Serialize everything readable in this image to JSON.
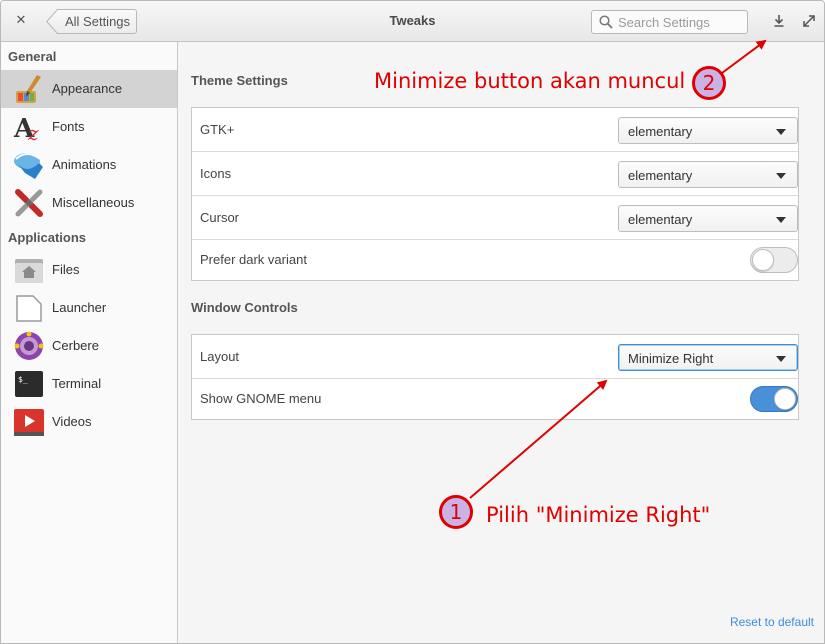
{
  "window": {
    "title": "Tweaks",
    "back_label": "All Settings",
    "close_glyph": "✕"
  },
  "search": {
    "placeholder": "Search Settings",
    "value": ""
  },
  "header_icons": [
    "minimize-icon",
    "maximize-icon"
  ],
  "sidebar": {
    "groups": [
      {
        "label": "General",
        "items": [
          {
            "label": "Appearance",
            "icon": "appearance-icon",
            "selected": true
          },
          {
            "label": "Fonts",
            "icon": "fonts-icon",
            "selected": false
          },
          {
            "label": "Animations",
            "icon": "animations-icon",
            "selected": false
          },
          {
            "label": "Miscellaneous",
            "icon": "miscellaneous-icon",
            "selected": false
          }
        ]
      },
      {
        "label": "Applications",
        "items": [
          {
            "label": "Files",
            "icon": "files-icon",
            "selected": false
          },
          {
            "label": "Launcher",
            "icon": "launcher-icon",
            "selected": false
          },
          {
            "label": "Cerbere",
            "icon": "cerbere-icon",
            "selected": false
          },
          {
            "label": "Terminal",
            "icon": "terminal-icon",
            "selected": false
          },
          {
            "label": "Videos",
            "icon": "videos-icon",
            "selected": false
          }
        ]
      }
    ]
  },
  "main": {
    "theme_settings": {
      "title": "Theme Settings",
      "rows": [
        {
          "label": "GTK+",
          "value": "elementary"
        },
        {
          "label": "Icons",
          "value": "elementary"
        },
        {
          "label": "Cursor",
          "value": "elementary"
        },
        {
          "label": "Prefer dark variant",
          "switch": false
        }
      ]
    },
    "window_controls": {
      "title": "Window Controls",
      "rows": [
        {
          "label": "Layout",
          "value": "Minimize Right"
        },
        {
          "label": "Show GNOME menu",
          "switch": true
        }
      ]
    },
    "reset_label": "Reset to default"
  },
  "annotations": {
    "note_2": {
      "number": "2",
      "text": "Minimize button akan muncul"
    },
    "note_1": {
      "number": "1",
      "text": "Pilih \"Minimize Right\""
    },
    "color": "#e00000"
  },
  "colors": {
    "accent": "#3d8ed8",
    "switch_on": "#4a90d9",
    "selected_row": "#d3d3d3"
  }
}
